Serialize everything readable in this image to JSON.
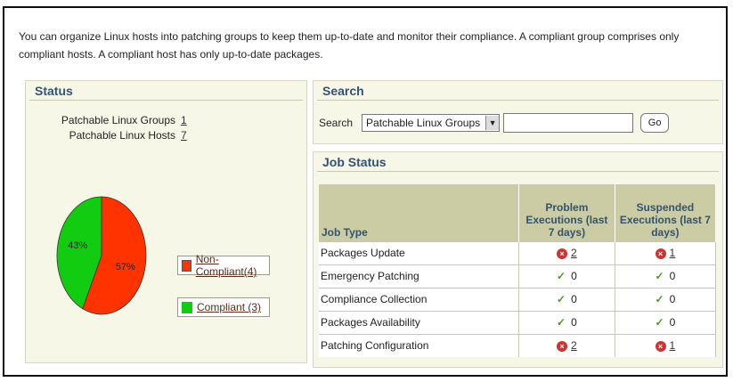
{
  "intro": "You can organize Linux hosts into patching groups to keep them up-to-date and monitor their compliance. A compliant group comprises only compliant hosts. A compliant host has only up-to-date packages.",
  "status": {
    "title": "Status",
    "groups_label": "Patchable Linux Groups",
    "groups_value": "1",
    "hosts_label": "Patchable Linux Hosts",
    "hosts_value": "7"
  },
  "chart_data": {
    "type": "pie",
    "slices": [
      {
        "name": "Non-Compliant",
        "value": 57,
        "label": "57%",
        "color": "#ff3300"
      },
      {
        "name": "Compliant",
        "value": 43,
        "label": "43%",
        "color": "#11cc11"
      }
    ],
    "legend": [
      "Non-Compliant(4)",
      "Compliant (3)"
    ]
  },
  "search": {
    "title": "Search",
    "label": "Search",
    "selected": "Patchable Linux Groups",
    "value": "",
    "go": "Go"
  },
  "job_status": {
    "title": "Job Status",
    "headers": [
      "Job Type",
      "Problem Executions (last 7 days)",
      "Suspended Executions (last 7 days)"
    ],
    "rows": [
      {
        "type": "Packages Update",
        "problem": "2",
        "problem_status": "error",
        "suspended": "1",
        "suspended_status": "error"
      },
      {
        "type": "Emergency Patching",
        "problem": "0",
        "problem_status": "ok",
        "suspended": "0",
        "suspended_status": "ok"
      },
      {
        "type": "Compliance Collection",
        "problem": "0",
        "problem_status": "ok",
        "suspended": "0",
        "suspended_status": "ok"
      },
      {
        "type": "Packages Availability",
        "problem": "0",
        "problem_status": "ok",
        "suspended": "0",
        "suspended_status": "ok"
      },
      {
        "type": "Patching Configuration",
        "problem": "2",
        "problem_status": "error",
        "suspended": "1",
        "suspended_status": "error"
      }
    ]
  }
}
